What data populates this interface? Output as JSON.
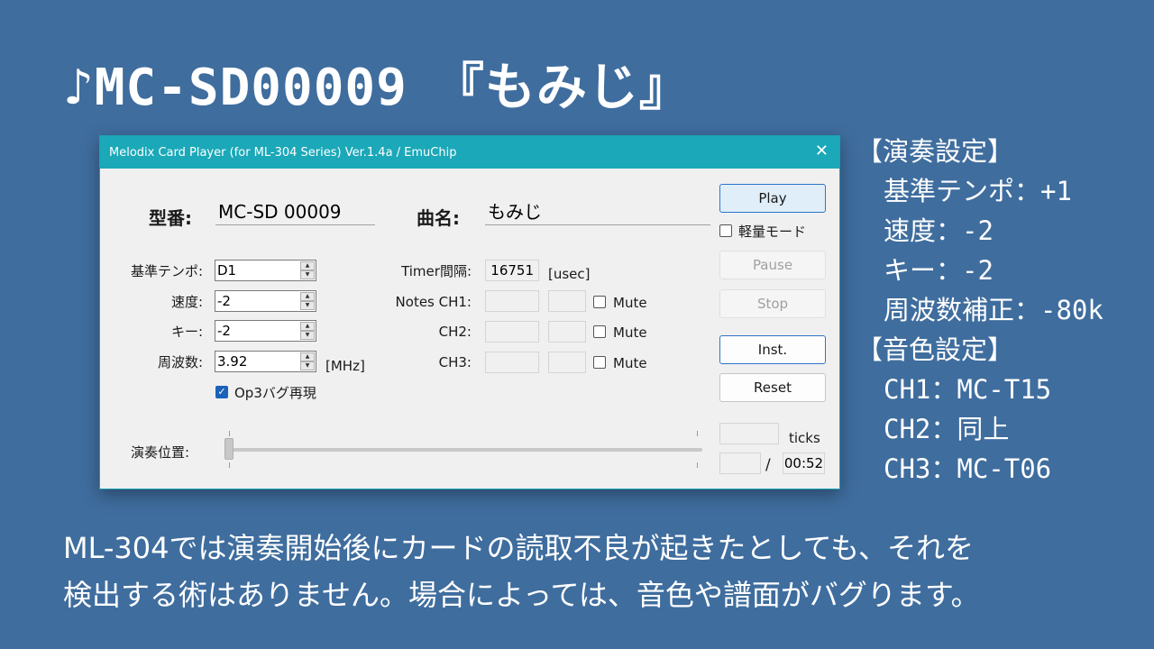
{
  "headline": "♪MC-SD00009　『もみじ』",
  "window": {
    "title": "Melodix Card Player (for ML-304 Series) Ver.1.4a / EmuChip",
    "model_label": "型番:",
    "model_value": "MC-SD 00009",
    "song_label": "曲名:",
    "song_value": "もみじ",
    "play_label": "Play",
    "light_mode_label": "軽量モード",
    "pause_label": "Pause",
    "stop_label": "Stop",
    "inst_label": "Inst.",
    "reset_label": "Reset",
    "tempo_label": "基準テンポ:",
    "tempo_value": "D1",
    "speed_label": "速度:",
    "speed_value": "-2",
    "key_label": "キー:",
    "key_value": "-2",
    "freq_label": "周波数:",
    "freq_value": "3.92",
    "freq_unit": "[MHz]",
    "op3_label": "Op3バグ再現",
    "timer_label": "Timer間隔:",
    "timer_value": "16751",
    "timer_unit": "[usec]",
    "notes_ch1_label": "Notes CH1:",
    "ch2_label": "CH2:",
    "ch3_label": "CH3:",
    "mute_label": "Mute",
    "position_label": "演奏位置:",
    "ticks_label": "ticks",
    "slash": "/",
    "duration": "00:52",
    "position_fraction": 0
  },
  "settings": {
    "perf_header": "【演奏設定】",
    "perf_items": [
      "基準テンポ：+1",
      "速度：-2",
      "キー：-2",
      "周波数補正：-80k"
    ],
    "tone_header": "【音色設定】",
    "tone_items": [
      "CH1：MC-T15",
      "CH2：同上",
      "CH3：MC-T06"
    ]
  },
  "caption": {
    "line1": "ML-304では演奏開始後にカードの読取不良が起きたとしても、それを",
    "line2": "検出する術はありません。場合によっては、音色や譜面がバグります。"
  }
}
